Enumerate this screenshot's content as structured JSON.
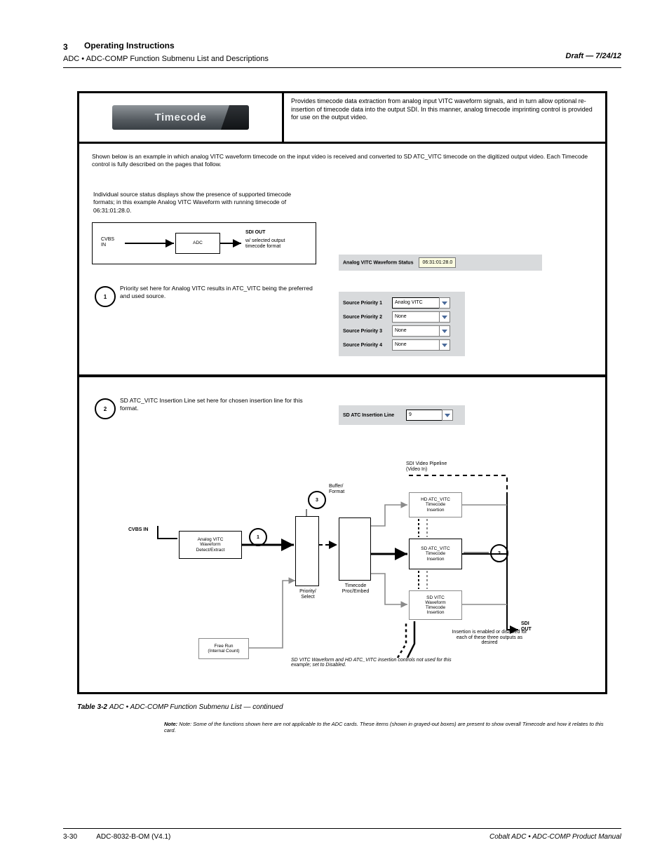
{
  "header": {
    "chapter": "3",
    "title": "Operating Instructions",
    "subtitle": "ADC • ADC-COMP Function Submenu List and Descriptions",
    "date": "Draft — 7/24/12"
  },
  "footer": {
    "page": "3-30",
    "manual_code": "ADC-8032-B-OM (V4.1)",
    "manual_title": "Cobalt ADC • ADC-COMP Product Manual"
  },
  "tab": {
    "label": "Timecode"
  },
  "cell_top_right": "Provides timecode data extraction from analog input VITC waveform signals, and in turn allow optional re-insertion of timecode data into the output SDI. In this manner, analog timecode imprinting control is provided for use on the output video.",
  "overview_text": "Shown below is an example in which analog VITC waveform timecode on the input video is received and converted to SD ATC_VITC timecode on the digitized output video. Each Timecode control is fully described on the pages that follow.",
  "source_status_desc": "Individual source status displays show the presence of supported timecode formats; in this example Analog VITC Waveform with running timecode of 06:31:01:28.0.",
  "circle1_desc": "Priority set here for Analog VITC results in ATC_VITC being the preferred and used source.",
  "circle2_desc": "SD ATC_VITC Insertion Line set here for chosen insertion line for this format.",
  "status_panel": {
    "label": "Analog VITC Waveform Status",
    "value": "06:31:01:28.0"
  },
  "priority_panel": {
    "row1_label": "Source Priority 1",
    "row1_value": "Analog VITC",
    "row2_label": "Source Priority 2",
    "row2_value": "None",
    "row3_label": "Source Priority 3",
    "row3_value": "None",
    "row4_label": "Source Priority 4",
    "row4_value": "None"
  },
  "atc_panel": {
    "label": "SD ATC Insertion Line",
    "value": "9"
  },
  "mini_diag": {
    "in_label": "CVBS\nIN",
    "box_label": "ADC",
    "out_label_top": "SDI OUT",
    "out_label_bottom": "w/ selected output\ntimecode format"
  },
  "big_diag": {
    "in_label": "CVBS IN",
    "analog_box": "Analog VITC\nWaveform\nDetect/Extract",
    "priority_box": " ",
    "proc_box": " ",
    "buffer_box": " ",
    "hd_atc_vitc": "HD ATC_VITC\nTimecode\nInsertion",
    "sd_atc_vitc": "SD ATC_VITC\nTimecode\nInsertion",
    "sd_vitc_wave": "SD VITC\nWaveform\nTimecode\nInsertion",
    "priority_label": "Priority/\nSelect",
    "proc_label": "Timecode\nProc/Embed",
    "buffer_label": "Buffer/\nFormat",
    "free_run": "Free Run\n(Internal Count)",
    "video_in_label": "SDI Video Pipeline\n(Video In)",
    "sdi_out_label": "SDI\nOUT",
    "bottom_note1": "SD VITC Waveform and HD ATC_VITC insertion\ncontrols not used for this example; set to Disabled.",
    "bottom_note2": "Insertion is enabled or disabled for each of these three outputs as desired"
  },
  "note_text": "Note: Some of the functions shown here are not applicable to the ADC cards. These items (shown in grayed-out boxes) are present to show overall Timecode and how it relates to this card.",
  "table_label": {
    "prefix": "Table 3-2",
    "rest": "ADC • ADC-COMP Function Submenu List — continued"
  },
  "chart_data": null
}
